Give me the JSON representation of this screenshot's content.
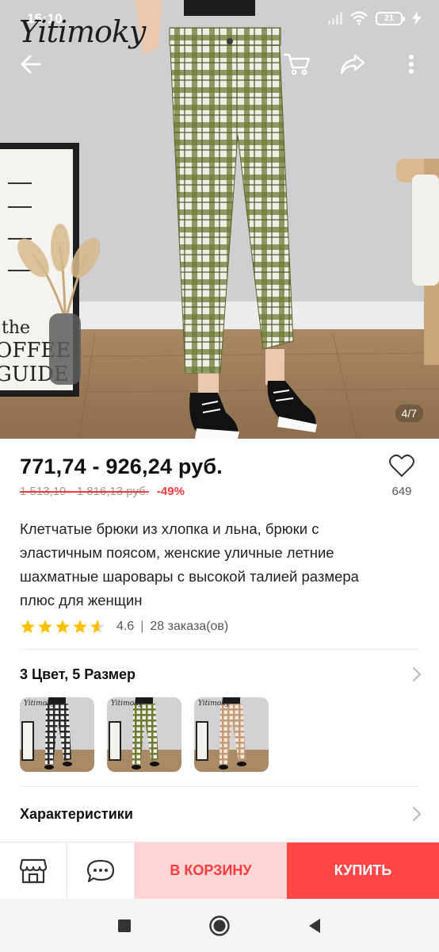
{
  "status_bar": {
    "time": "15:10",
    "battery": "21"
  },
  "hero": {
    "brand_logo": "Yitimoky",
    "page_indicator": "4/7",
    "poster_text": "the\nOFFEE\nGUIDE",
    "icons": [
      "back-arrow-icon",
      "cart-icon",
      "share-icon",
      "more-vert-icon"
    ]
  },
  "product": {
    "price": "771,74 - 926,24 руб.",
    "old_price": "1 513,19 - 1 816,13 руб.",
    "discount": "-49%",
    "favorites_count": "649",
    "title": "Клетчатые брюки из хлопка и льна, брюки с эластичным поясом, женские уличные летние шахматные шаровары с высокой талией размера плюс для женщин",
    "rating": "4.6",
    "rating_stars": 4.6,
    "orders": "28 заказа(ов)"
  },
  "variants": {
    "label": "3 Цвет, 5 Размер",
    "thumb_logo": "Yitimoky",
    "colors": [
      {
        "name": "black-white",
        "check_dark": "#2a2a2a",
        "check_light": "#f2f2f2"
      },
      {
        "name": "green-white",
        "check_dark": "#6f7a35",
        "check_light": "#f0f0e8"
      },
      {
        "name": "beige",
        "check_dark": "#c49a78",
        "check_light": "#f3e7dc"
      }
    ]
  },
  "specs": {
    "label": "Характеристики"
  },
  "actions": {
    "add_to_cart": "В КОРЗИНУ",
    "buy": "КУПИТЬ"
  },
  "colors": {
    "accent": "#ff4747",
    "accent_light": "#ffd5d5",
    "star": "#ffc107",
    "discount": "#ff3b3b"
  }
}
